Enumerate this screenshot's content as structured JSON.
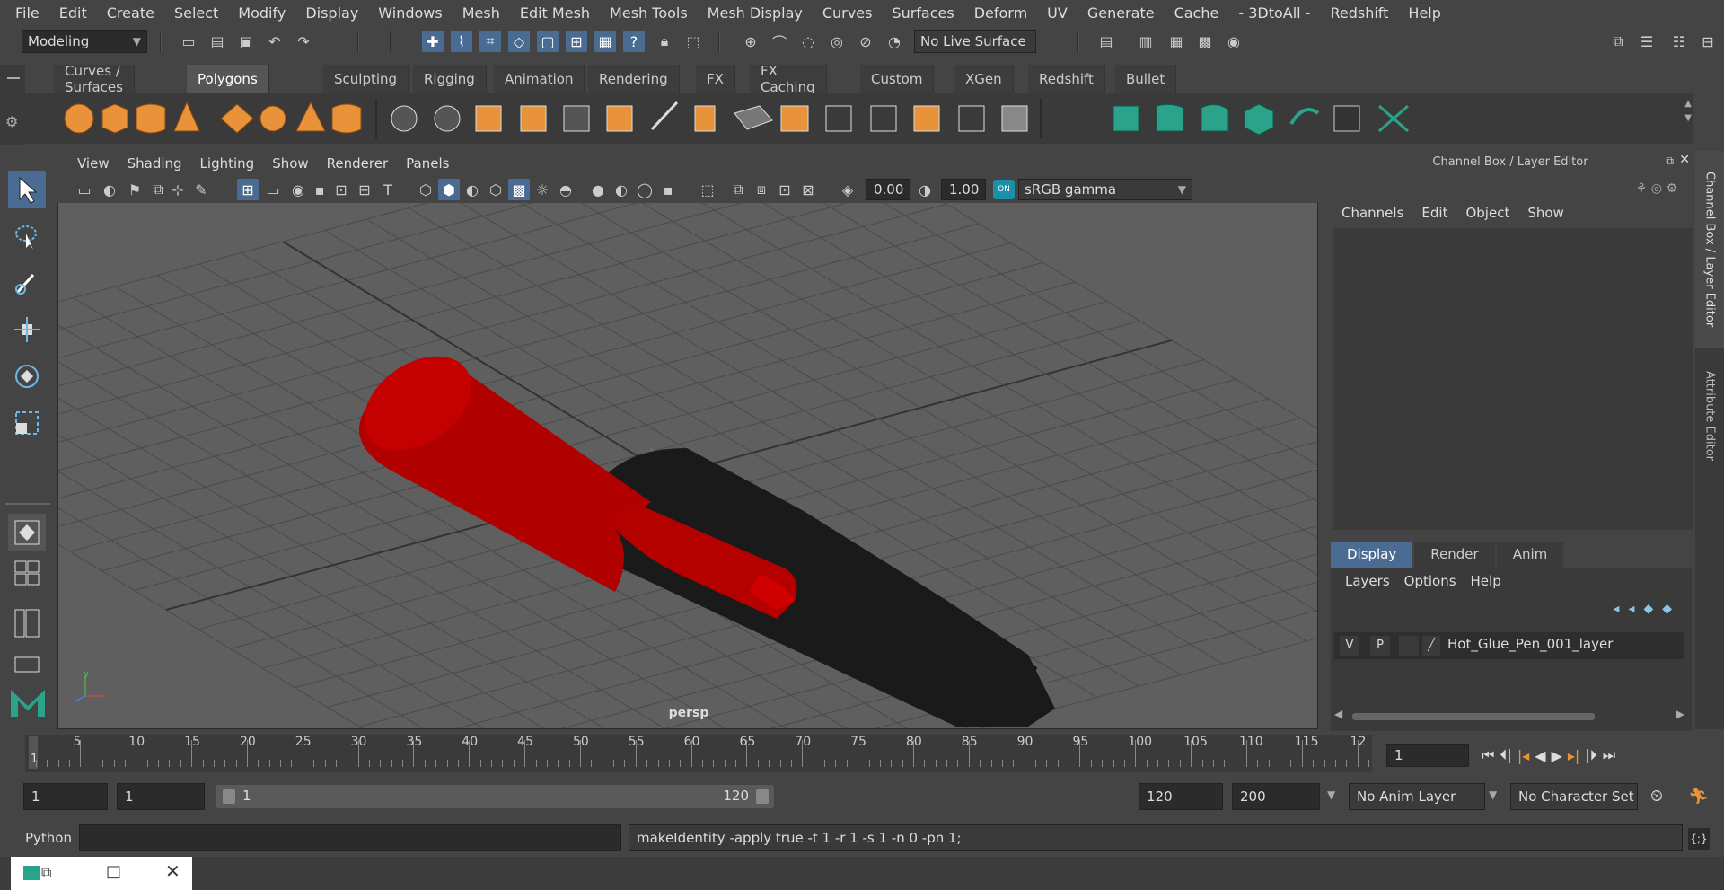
{
  "menubar": [
    "File",
    "Edit",
    "Create",
    "Select",
    "Modify",
    "Display",
    "Windows",
    "Mesh",
    "Edit Mesh",
    "Mesh Tools",
    "Mesh Display",
    "Curves",
    "Surfaces",
    "Deform",
    "UV",
    "Generate",
    "Cache",
    "- 3DtoAll -",
    "Redshift",
    "Help"
  ],
  "status": {
    "workspace": "Modeling",
    "live_surface": "No Live Surface"
  },
  "shelf_tabs": [
    "Curves / Surfaces",
    "Polygons",
    "Sculpting",
    "Rigging",
    "Animation",
    "Rendering",
    "FX",
    "FX Caching",
    "Custom",
    "XGen",
    "Redshift",
    "Bullet"
  ],
  "shelf_active": "Polygons",
  "viewport": {
    "menu": [
      "View",
      "Shading",
      "Lighting",
      "Show",
      "Renderer",
      "Panels"
    ],
    "exposure": "0.00",
    "gamma": "1.00",
    "colorspace": "sRGB gamma",
    "camera_label": "persp"
  },
  "channel_box": {
    "title": "Channel Box / Layer Editor",
    "menu": [
      "Channels",
      "Edit",
      "Object",
      "Show"
    ],
    "layer_tabs": [
      "Display",
      "Render",
      "Anim"
    ],
    "layer_menu": [
      "Layers",
      "Options",
      "Help"
    ],
    "layer": {
      "v": "V",
      "p": "P",
      "name": "Hot_Glue_Pen_001_layer"
    }
  },
  "side_tabs": [
    "Channel Box / Layer Editor",
    "Attribute Editor"
  ],
  "timeline": {
    "ticks": [
      "5",
      "10",
      "15",
      "20",
      "25",
      "30",
      "35",
      "40",
      "45",
      "50",
      "55",
      "60",
      "65",
      "70",
      "75",
      "80",
      "85",
      "90",
      "95",
      "100",
      "105",
      "110",
      "115",
      "12"
    ],
    "current_frame_marker": "1",
    "current_frame": "1"
  },
  "range": {
    "start": "1",
    "playback_start": "1",
    "slider_start": "1",
    "slider_end": "120",
    "playback_end": "120",
    "end": "200",
    "anim_layer": "No Anim Layer",
    "char_set": "No Character Set"
  },
  "cmd": {
    "lang": "Python",
    "output": "makeIdentity -apply true -t 1 -r 1 -s 1 -n 0 -pn 1;"
  },
  "colors": {
    "accent": "#4a6c92",
    "pen_red": "#b00000",
    "pen_black": "#1a1a1a",
    "icon_orange": "#e8923a",
    "icon_teal": "#2aa38a"
  }
}
